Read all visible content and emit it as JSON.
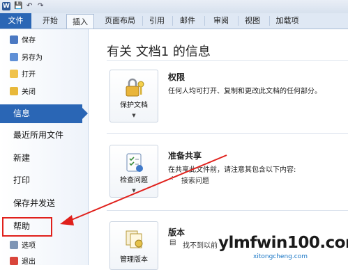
{
  "titlebar": {
    "app_icon": "word-icon",
    "quick_access": [
      "save-icon",
      "undo-icon",
      "redo-icon"
    ]
  },
  "ribbon": {
    "file_tab": "文件",
    "tabs": [
      "开始",
      "插入",
      "页面布局",
      "引用",
      "邮件",
      "审阅",
      "视图",
      "加载项"
    ],
    "active_tab": "插入"
  },
  "nav": {
    "small_items": [
      {
        "label": "保存",
        "icon": "save-icon"
      },
      {
        "label": "另存为",
        "icon": "save-as-icon"
      },
      {
        "label": "打开",
        "icon": "open-folder-icon"
      },
      {
        "label": "关闭",
        "icon": "close-folder-icon"
      }
    ],
    "active_item": "信息",
    "big_items": [
      "最近所用文件",
      "新建",
      "打印",
      "保存并发送",
      "帮助"
    ],
    "bottom_items": [
      {
        "label": "选项",
        "icon": "options-icon"
      },
      {
        "label": "退出",
        "icon": "exit-icon"
      }
    ]
  },
  "main": {
    "title": "有关 文档1 的信息",
    "sections": [
      {
        "button": "保护文档",
        "icon": "lock-key-icon",
        "title": "权限",
        "desc": "任何人均可打开、复制和更改此文档的任何部分。"
      },
      {
        "button": "检查问题",
        "icon": "checklist-icon",
        "title": "准备共享",
        "desc": "在共享此文件前，请注意其包含以下内容:",
        "bullets": [
          "接索问题"
        ]
      },
      {
        "button": "管理版本",
        "icon": "versions-icon",
        "title": "版本",
        "bullets": [
          "找不到以前"
        ]
      }
    ]
  },
  "watermark": {
    "main": "ylmfwin100.com",
    "sub": "xitongcheng.com"
  },
  "colors": {
    "accent": "#2a66b5",
    "highlight_box": "#e0201b",
    "arrow": "#e0201b"
  }
}
